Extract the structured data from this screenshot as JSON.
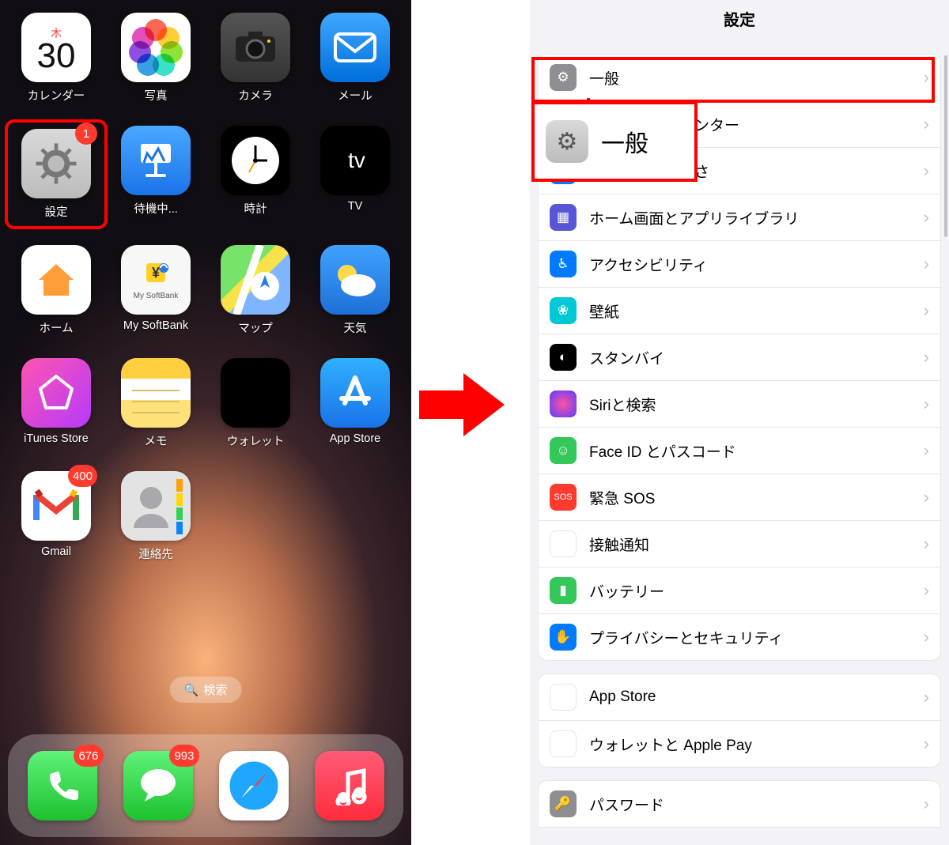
{
  "home": {
    "calendar": {
      "dow": "木",
      "day": "30",
      "label": "カレンダー"
    },
    "apps": [
      {
        "id": "photos",
        "label": "写真"
      },
      {
        "id": "camera",
        "label": "カメラ"
      },
      {
        "id": "mail",
        "label": "メール"
      },
      {
        "id": "settings",
        "label": "設定",
        "badge": "1"
      },
      {
        "id": "keynote",
        "label": "待機中..."
      },
      {
        "id": "clock",
        "label": "時計"
      },
      {
        "id": "tv",
        "label": "TV"
      },
      {
        "id": "home",
        "label": "ホーム"
      },
      {
        "id": "softbank",
        "label": "My SoftBank",
        "sb_text": "My SoftBank"
      },
      {
        "id": "maps",
        "label": "マップ"
      },
      {
        "id": "weather",
        "label": "天気"
      },
      {
        "id": "itunes",
        "label": "iTunes Store"
      },
      {
        "id": "notes",
        "label": "メモ"
      },
      {
        "id": "wallet",
        "label": "ウォレット"
      },
      {
        "id": "appstore",
        "label": "App Store"
      },
      {
        "id": "gmail",
        "label": "Gmail",
        "badge": "400"
      },
      {
        "id": "contacts",
        "label": "連絡先"
      }
    ],
    "search": "検索",
    "dock": [
      {
        "id": "phone",
        "badge": "676"
      },
      {
        "id": "msg",
        "badge": "993"
      },
      {
        "id": "safari"
      },
      {
        "id": "music"
      }
    ]
  },
  "settings": {
    "title": "設定",
    "callout_label": "一般",
    "group1": [
      {
        "id": "general",
        "label": "一般",
        "icon_bg": "bg-gray",
        "glyph": "⚙"
      },
      {
        "id": "controlcenter",
        "label": "コントロールセンター",
        "icon_bg": "bg-gray2",
        "glyph": "⊟"
      },
      {
        "id": "display",
        "label": "画面表示と明るさ",
        "icon_bg": "bg-blue",
        "glyph": "AA"
      },
      {
        "id": "homescreen",
        "label": "ホーム画面とアプリライブラリ",
        "icon_bg": "bg-purple",
        "glyph": "▦"
      },
      {
        "id": "accessibility",
        "label": "アクセシビリティ",
        "icon_bg": "bg-blue",
        "glyph": "♿︎"
      },
      {
        "id": "wallpaper",
        "label": "壁紙",
        "icon_bg": "bg-teal",
        "glyph": "❀"
      },
      {
        "id": "standby",
        "label": "スタンバイ",
        "icon_bg": "bg-black",
        "glyph": "◐"
      },
      {
        "id": "siri",
        "label": "Siriと検索",
        "icon_bg": "bg-siri",
        "glyph": ""
      },
      {
        "id": "faceid",
        "label": "Face ID とパスコード",
        "icon_bg": "bg-green",
        "glyph": "☺︎"
      },
      {
        "id": "sos",
        "label": "緊急 SOS",
        "icon_bg": "bg-red",
        "glyph": "SOS"
      },
      {
        "id": "exposure",
        "label": "接触通知",
        "icon_bg": "bg-white",
        "glyph": "⦿"
      },
      {
        "id": "battery",
        "label": "バッテリー",
        "icon_bg": "bg-green",
        "glyph": "▮"
      },
      {
        "id": "privacy",
        "label": "プライバシーとセキュリティ",
        "icon_bg": "bg-privacy",
        "glyph": "✋"
      }
    ],
    "group2": [
      {
        "id": "appstore2",
        "label": "App Store",
        "icon_bg": "bg-appstore",
        "glyph": "A"
      },
      {
        "id": "walletpay",
        "label": "ウォレットと Apple Pay",
        "icon_bg": "bg-wallet",
        "glyph": "▭"
      }
    ],
    "group3": [
      {
        "id": "passwords",
        "label": "パスワード",
        "icon_bg": "bg-key",
        "glyph": "🔑"
      }
    ]
  }
}
